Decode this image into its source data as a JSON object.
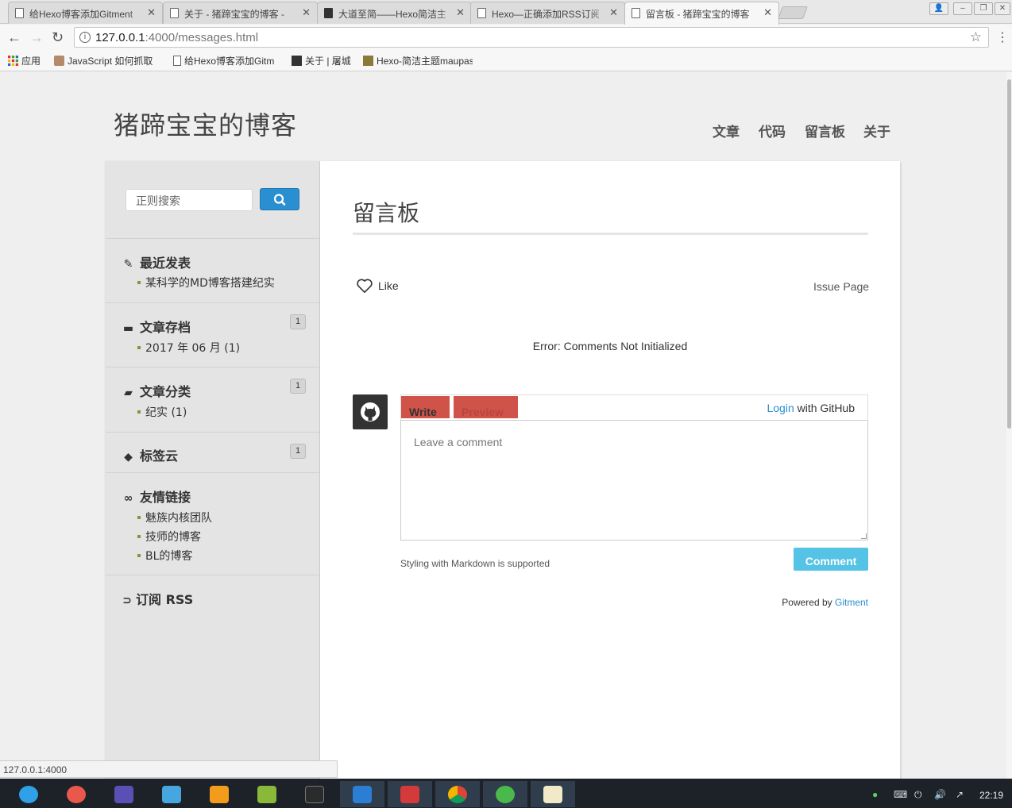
{
  "browser": {
    "tabs": [
      {
        "title": "给Hexo博客添加Gitment",
        "active": false
      },
      {
        "title": "关于 - 猪蹄宝宝的博客 - ",
        "active": false
      },
      {
        "title": "大道至简——Hexo简洁主",
        "active": false
      },
      {
        "title": "Hexo—正确添加RSS订阅",
        "active": false
      },
      {
        "title": "留言板 - 猪蹄宝宝的博客",
        "active": true
      }
    ],
    "url_host": "127.0.0.1",
    "url_rest": ":4000/messages.html",
    "bookmarks": [
      {
        "label": "应用",
        "icon": "apps-grid-icon"
      },
      {
        "label": "JavaScript 如何抓取",
        "icon": "avatar-favicon"
      },
      {
        "label": "给Hexo博客添加Gitm",
        "icon": "page-icon"
      },
      {
        "label": "关于 | 屠城",
        "icon": "cube-favicon"
      },
      {
        "label": "Hexo-简洁主题maupas",
        "icon": "photo-favicon"
      }
    ],
    "status_url": "127.0.0.1:4000"
  },
  "site": {
    "title": "猪蹄宝宝的博客",
    "nav": [
      "文章",
      "代码",
      "留言板",
      "关于"
    ]
  },
  "sidebar": {
    "search_placeholder": "正则搜索",
    "recent": {
      "heading": "最近发表",
      "items": [
        "某科学的MD博客搭建纪实"
      ]
    },
    "archive": {
      "heading": "文章存档",
      "count": "1",
      "items": [
        "2017 年 06 月 (1)"
      ]
    },
    "category": {
      "heading": "文章分类",
      "count": "1",
      "items": [
        "纪实 (1)"
      ]
    },
    "tags": {
      "heading": "标签云",
      "count": "1"
    },
    "links": {
      "heading": "友情链接",
      "items": [
        "魅族内核团队",
        "技师的博客",
        "BL的博客"
      ]
    },
    "rss": {
      "heading": "订阅 RSS"
    }
  },
  "main": {
    "heading": "留言板",
    "like_label": "Like",
    "issue_page_label": "Issue Page",
    "error": "Error: Comments Not Initialized",
    "write_tab": "Write",
    "preview_tab": "Preview",
    "login_link": "Login",
    "login_suffix": " with GitHub",
    "comment_placeholder": "Leave a comment",
    "markdown_note": "Styling with Markdown is supported",
    "comment_button": "Comment",
    "powered_by": "Powered by ",
    "powered_link": "Gitment"
  },
  "taskbar": {
    "clock": "22:19",
    "apps": [
      "launcher",
      "screen-recorder",
      "editor",
      "store",
      "files",
      "music",
      "system-monitor",
      "vscode",
      "terminal",
      "chrome",
      "telegram",
      "notes"
    ]
  },
  "colors": {
    "accent": "#2a8fd0",
    "tab_red": "#d0534a",
    "comment_button": "#54c3e5"
  }
}
